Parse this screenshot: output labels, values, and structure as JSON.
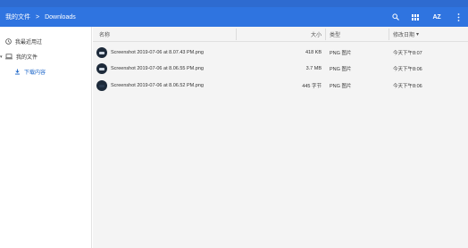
{
  "breadcrumb": {
    "items": [
      "我的文件",
      "Downloads"
    ],
    "separator": ">"
  },
  "toolbar": {
    "sort_label": "AZ"
  },
  "sidebar": {
    "items": [
      {
        "label": "我最近用过",
        "icon": "clock-icon"
      },
      {
        "label": "我的文件",
        "icon": "laptop-icon"
      },
      {
        "label": "下载内容",
        "icon": "download-icon"
      }
    ]
  },
  "table": {
    "columns": {
      "name": "名称",
      "size": "大小",
      "type": "类型",
      "modified": "修改日期"
    },
    "sort_indicator": "▾",
    "rows": [
      {
        "name": "Screenshot 2019-07-06 at 8.07.43 PM.png",
        "size": "418 KB",
        "type": "PNG 图片",
        "modified": "今天下午8:07"
      },
      {
        "name": "Screenshot 2019-07-06 at 8.06.55 PM.png",
        "size": "3.7 MB",
        "type": "PNG 图片",
        "modified": "今天下午8:06"
      },
      {
        "name": "Screenshot 2019-07-06 at 8.06.52 PM.png",
        "size": "445 字节",
        "type": "PNG 图片",
        "modified": "今天下午8:06"
      }
    ]
  },
  "colors": {
    "titlebar": "#2f74e0",
    "accent": "#1a64c8"
  }
}
